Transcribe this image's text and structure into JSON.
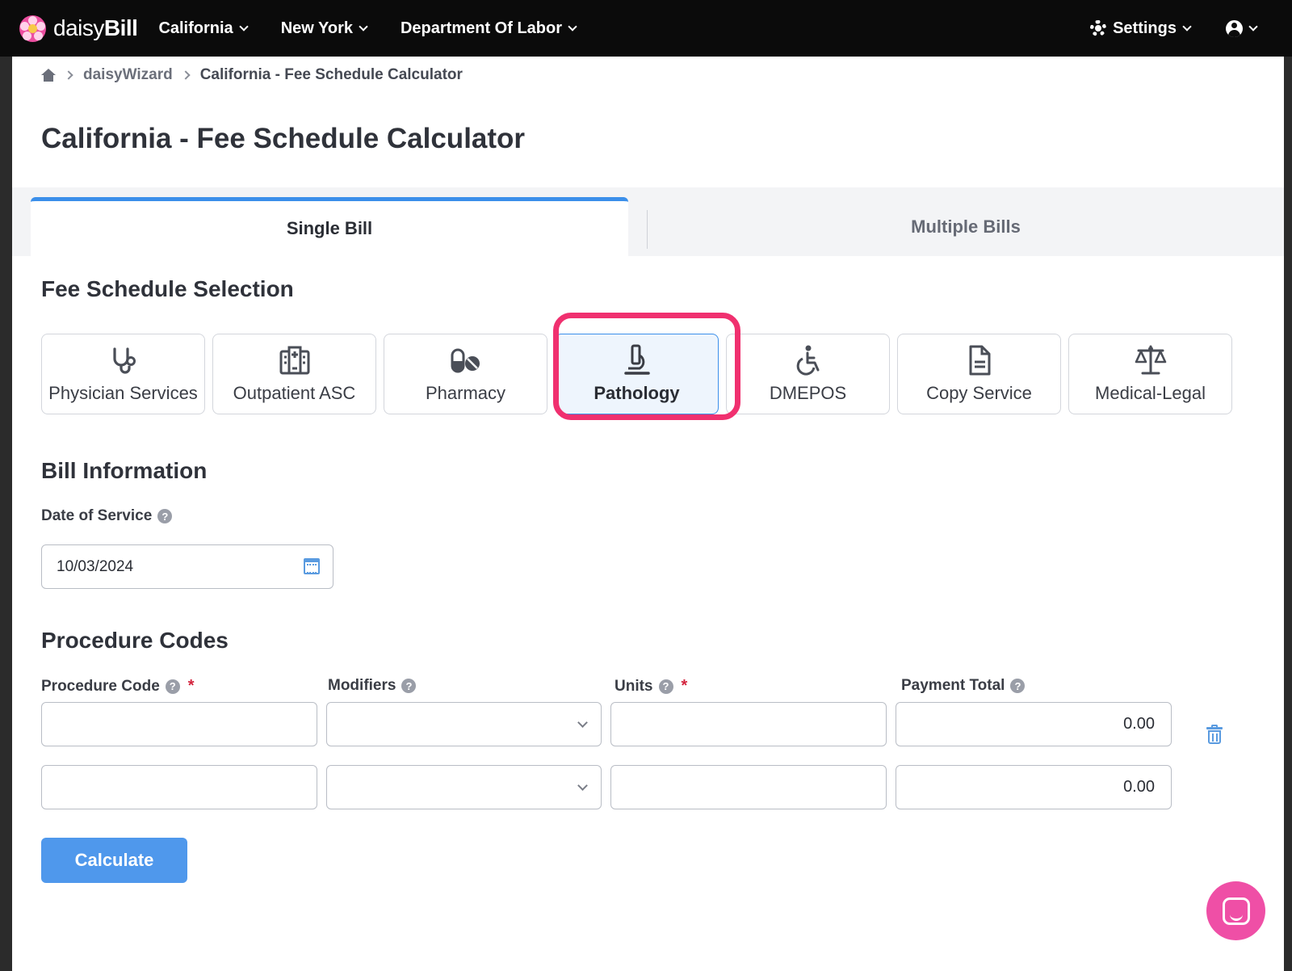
{
  "brand": {
    "light": "daisy",
    "bold": "Bill"
  },
  "nav": {
    "items": [
      {
        "label": "California"
      },
      {
        "label": "New York"
      },
      {
        "label": "Department Of Labor"
      }
    ],
    "settings_label": "Settings"
  },
  "breadcrumb": {
    "items": [
      "daisyWizard",
      "California - Fee Schedule Calculator"
    ]
  },
  "page_title": "California - Fee Schedule Calculator",
  "tabs": [
    {
      "label": "Single Bill",
      "active": true
    },
    {
      "label": "Multiple Bills",
      "active": false
    }
  ],
  "fee_schedule": {
    "title": "Fee Schedule Selection",
    "selected": "Pathology",
    "options": [
      {
        "label": "Physician Services",
        "icon": "stethoscope-icon"
      },
      {
        "label": "Outpatient ASC",
        "icon": "hospital-icon"
      },
      {
        "label": "Pharmacy",
        "icon": "pills-icon"
      },
      {
        "label": "Pathology",
        "icon": "microscope-icon"
      },
      {
        "label": "DMEPOS",
        "icon": "wheelchair-icon"
      },
      {
        "label": "Copy Service",
        "icon": "document-icon"
      },
      {
        "label": "Medical-Legal",
        "icon": "scale-icon"
      }
    ]
  },
  "bill_info": {
    "title": "Bill Information",
    "date_label": "Date of Service",
    "date_value": "10/03/2024"
  },
  "procedure_codes": {
    "title": "Procedure Codes",
    "columns": {
      "code": "Procedure Code",
      "modifiers": "Modifiers",
      "units": "Units",
      "payment": "Payment Total"
    },
    "required_mark": "*",
    "help_mark": "?",
    "rows": [
      {
        "code": "",
        "modifiers": "",
        "units": "",
        "payment": "0.00"
      },
      {
        "code": "",
        "modifiers": "",
        "units": "",
        "payment": "0.00"
      }
    ]
  },
  "calculate_label": "Calculate",
  "colors": {
    "accent": "#3b8fea",
    "highlight": "#f0306f",
    "chat": "#ef4fa6",
    "topbar": "#0b0b0b"
  }
}
